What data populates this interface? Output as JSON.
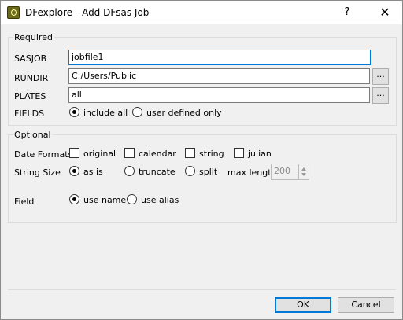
{
  "window": {
    "title": "DFexplore - Add DFsas Job",
    "help": "?",
    "close": "✕"
  },
  "required": {
    "title": "Required",
    "sasjob": {
      "label": "SASJOB",
      "value": "jobfile1"
    },
    "rundir": {
      "label": "RUNDIR",
      "value": "C:/Users/Public",
      "browse": "..."
    },
    "plates": {
      "label": "PLATES",
      "value": "all",
      "browse": "..."
    },
    "fields": {
      "label": "FIELDS",
      "options": [
        {
          "label": "include all",
          "checked": true
        },
        {
          "label": "user defined only",
          "checked": false
        }
      ]
    }
  },
  "optional": {
    "title": "Optional",
    "date_formats": {
      "label": "Date Formats",
      "options": [
        {
          "label": "original",
          "checked": false
        },
        {
          "label": "calendar",
          "checked": false
        },
        {
          "label": "string",
          "checked": false
        },
        {
          "label": "julian",
          "checked": false
        }
      ]
    },
    "string_size": {
      "label": "String Size",
      "options": [
        {
          "label": "as is",
          "checked": true
        },
        {
          "label": "truncate",
          "checked": false
        },
        {
          "label": "split",
          "checked": false
        }
      ],
      "max_length_label": "max length",
      "max_length_value": "200"
    },
    "field": {
      "label": "Field",
      "options": [
        {
          "label": "use name",
          "checked": true
        },
        {
          "label": "use alias",
          "checked": false
        }
      ]
    }
  },
  "buttons": {
    "ok": "OK",
    "cancel": "Cancel"
  },
  "colors": {
    "accent": "#0078d7",
    "background": "#f0f0f0"
  }
}
